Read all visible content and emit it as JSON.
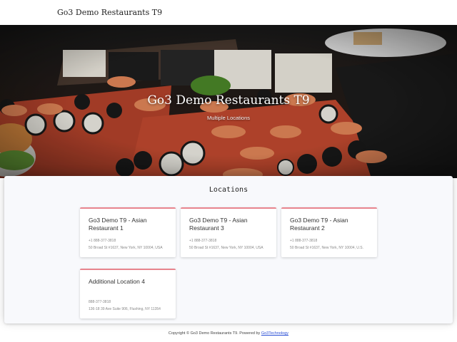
{
  "header": {
    "brand": "Go3 Demo Restaurants T9"
  },
  "hero": {
    "title": "Go3 Demo Restaurants T9",
    "subtitle": "Multiple Locations"
  },
  "locations": {
    "heading": "Locations",
    "cards": [
      {
        "name": "Go3 Demo T9 - Asian Restaurant 1",
        "phone": "+1 888-377-3818",
        "address": "50 Broad St #1637, New York, NY 10004, USA"
      },
      {
        "name": "Go3 Demo T9 - Asian Restaurant 3",
        "phone": "+1 888-377-3818",
        "address": "50 Broad St #1637, New York, NY 10004, USA"
      },
      {
        "name": "Go3 Demo T9 - Asian Restaurant 2",
        "phone": "+1 888-377-3818",
        "address": "50 Broad St #1637, New York, NY 10004, U.S."
      },
      {
        "name": "Additional Location 4",
        "phone": "888-377-3818",
        "address": "136-18 39 Ave Suite 906, Flushing, NY 11354"
      }
    ]
  },
  "footer": {
    "text": "Copyright © Go3 Demo Restaurants T9. Powered by",
    "link": "Go3Technology"
  },
  "colors": {
    "card_accent": "#e8848e",
    "link": "#2a4fd6"
  }
}
